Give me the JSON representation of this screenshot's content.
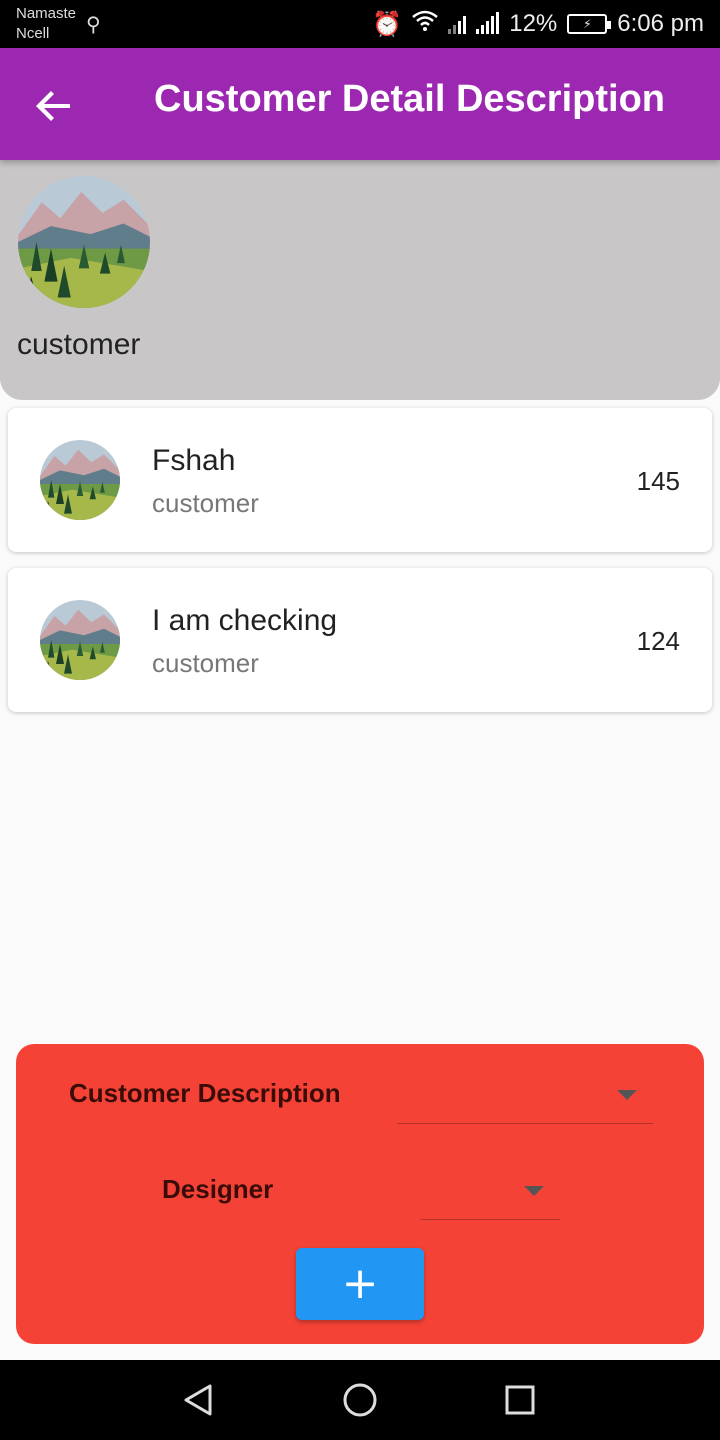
{
  "status_bar": {
    "carrier_line1": "Namaste",
    "carrier_line2": "Ncell",
    "battery_percent": "12%",
    "time": "6:06 pm"
  },
  "app_bar": {
    "title": "Customer Detail Description",
    "back_icon": "arrow-back-icon",
    "color": "#9c27b0"
  },
  "header": {
    "label": "customer",
    "panel_color": "#c8c6c7"
  },
  "customers": [
    {
      "name": "Fshah",
      "role": "customer",
      "count": "145"
    },
    {
      "name": "I am checking",
      "role": "customer",
      "count": "124"
    }
  ],
  "form": {
    "panel_color": "#f44336",
    "description_label": "Customer Description",
    "designer_label": "Designer",
    "add_button_label": "+",
    "button_color": "#2196f3"
  },
  "nav": {
    "icons": [
      "nav-back-icon",
      "nav-home-icon",
      "nav-recent-icon"
    ]
  }
}
